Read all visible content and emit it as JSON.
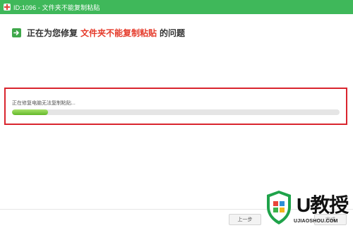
{
  "window": {
    "title": "ID:1096 - 文件夹不能复制粘贴"
  },
  "heading": {
    "prefix": "正在为您修复",
    "highlight": "文件夹不能复制粘贴",
    "suffix": "的问题"
  },
  "progress": {
    "status": "正在修复电脑无法复制粘贴...",
    "fraction": 0.11
  },
  "footer": {
    "prev_label": "上一步",
    "next_label": "完成"
  },
  "watermark": {
    "brand": "U教授",
    "domain": "UJIAOSHOU.COM"
  },
  "colors": {
    "titlebar": "#3fb85a",
    "highlight": "#e53a2a",
    "frame": "#d9252e",
    "progress": "#62b82a"
  }
}
